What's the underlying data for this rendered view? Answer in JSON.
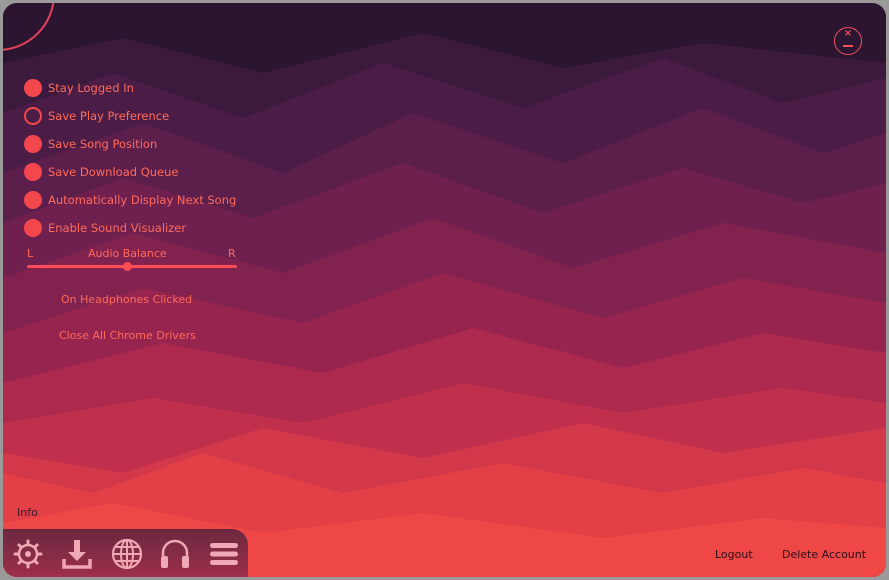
{
  "window": {
    "colors": {
      "accent": "#f4474d",
      "text": "#ff6b5a",
      "bg_dark": "#2c1530"
    }
  },
  "close_button": {
    "icon": "close-icon"
  },
  "settings": {
    "options": [
      {
        "label": "Stay Logged In",
        "checked": true
      },
      {
        "label": "Save Play Preference",
        "checked": false
      },
      {
        "label": "Save Song Position",
        "checked": true
      },
      {
        "label": "Save Download Queue",
        "checked": true
      },
      {
        "label": "Automatically Display Next Song",
        "checked": true
      },
      {
        "label": "Enable Sound Visualizer",
        "checked": true
      }
    ]
  },
  "audio_balance": {
    "title": "Audio Balance",
    "left_label": "L",
    "right_label": "R",
    "value": 0.48
  },
  "actions": {
    "headphones": "On Headphones Clicked",
    "close_drivers": "Close All Chrome Drivers"
  },
  "info_label": "Info",
  "nav": {
    "icons": [
      "settings-gear-icon",
      "download-icon",
      "globe-icon",
      "headphones-icon",
      "menu-icon"
    ]
  },
  "account": {
    "logout": "Logout",
    "delete": "Delete Account"
  }
}
